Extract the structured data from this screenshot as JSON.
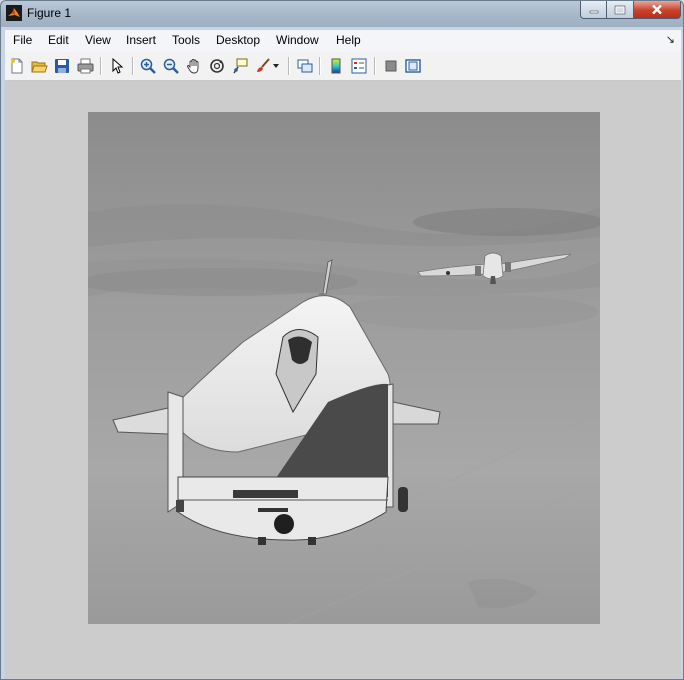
{
  "window": {
    "title": "Figure 1",
    "icon": "matlab-logo-icon"
  },
  "window_controls": [
    "minimize-icon",
    "maximize-icon",
    "close-icon"
  ],
  "menu": {
    "items": [
      {
        "label": "File"
      },
      {
        "label": "Edit"
      },
      {
        "label": "View"
      },
      {
        "label": "Insert"
      },
      {
        "label": "Tools"
      },
      {
        "label": "Desktop"
      },
      {
        "label": "Window"
      },
      {
        "label": "Help"
      }
    ],
    "dock_arrow": "↘"
  },
  "toolbar": {
    "icons": [
      "new-figure-icon",
      "open-file-icon",
      "save-icon",
      "print-icon",
      "edit-plot-arrow-icon",
      "zoom-in-icon",
      "zoom-out-icon",
      "pan-hand-icon",
      "rotate-3d-icon",
      "data-cursor-icon",
      "brush-icon",
      "brush-dropdown-icon",
      "link-plot-icon",
      "insert-colorbar-icon",
      "insert-legend-icon",
      "hide-plot-tools-icon",
      "show-plot-tools-icon"
    ]
  },
  "colors": {
    "figure_background": "#cccccc",
    "toolbar_background": "#f2f2f2",
    "menubar_background": "#f3f5f8",
    "close_button": "#c8432c"
  },
  "image": {
    "description_icon": "grayscale-photo-aircraft-icon",
    "colormap": "gray"
  }
}
